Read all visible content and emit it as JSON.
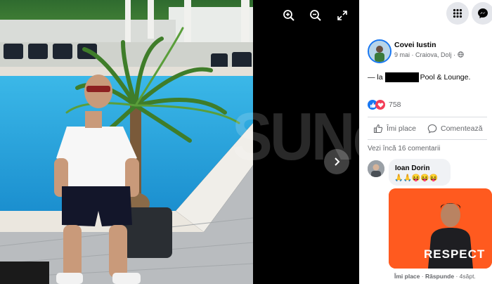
{
  "viewer": {
    "watermark": "SUNe",
    "icons": {
      "zoom_in": "zoom-in-icon",
      "zoom_out": "zoom-out-icon",
      "fullscreen": "fullscreen-icon",
      "next": "chevron-right-icon"
    },
    "photo_alt": "Man in white t-shirt by pool with palm tree"
  },
  "topbar": {
    "menu_icon": "grid-menu-icon",
    "messenger_icon": "messenger-icon"
  },
  "post": {
    "author": "Covei Iustin",
    "date": "9 mai",
    "separator": "·",
    "location": "Craiova, Dolj",
    "privacy_icon": "globe-icon",
    "text_prefix": "— la",
    "text_suffix": "Pool & Lounge.",
    "reaction_count": "758",
    "reactions": [
      "like",
      "love"
    ]
  },
  "actions": {
    "like": "Îmi place",
    "comment": "Comentează"
  },
  "comments": {
    "more_label": "Vezi încă 16 comentarii",
    "items": [
      {
        "name": "Ioan Dorin",
        "emojis": "🙏🙏😝😝😝",
        "gif_text": "RESPECT",
        "like": "Îmi place",
        "reply": "Răspunde",
        "time": "4săpt."
      }
    ]
  },
  "colors": {
    "accent": "#1877f2",
    "gif_bg": "#ff5a1f",
    "pool": "#1fa3dc"
  }
}
